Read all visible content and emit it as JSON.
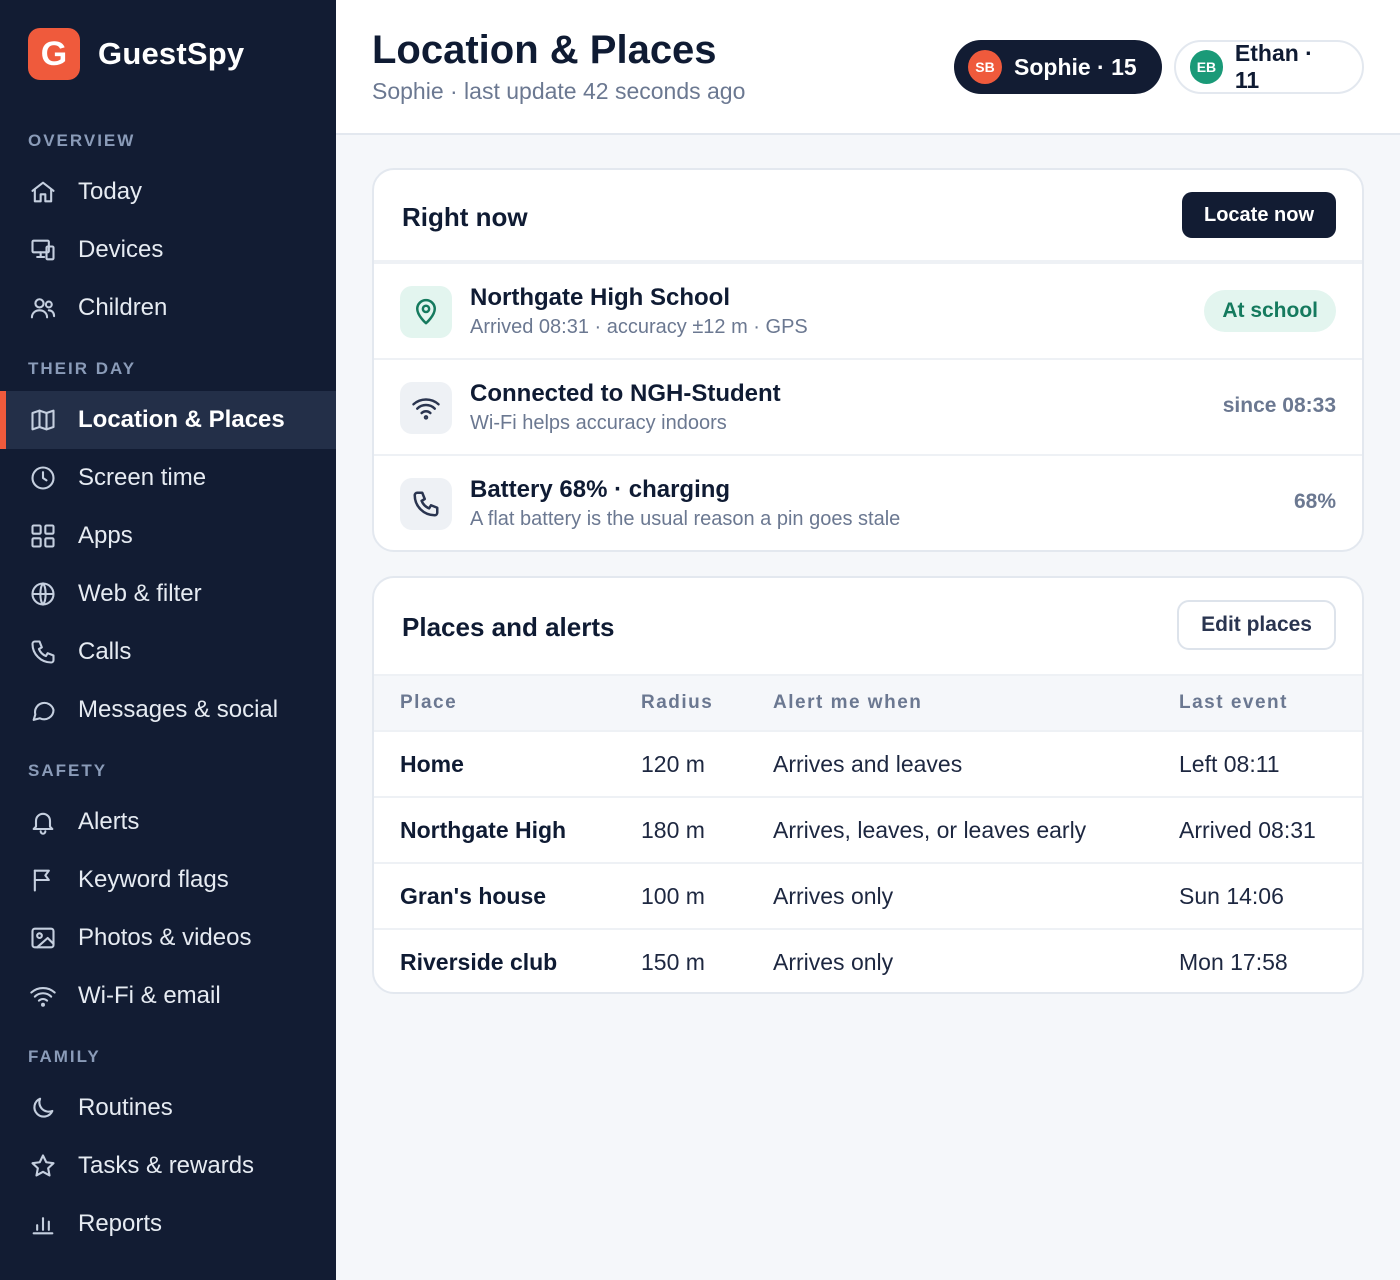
{
  "brand": {
    "logo_letter": "G",
    "name": "GuestSpy",
    "accent": "#ef5a3c"
  },
  "sidebar": {
    "sections": [
      {
        "label": "OVERVIEW",
        "items": [
          {
            "label": "Today",
            "icon": "home-icon"
          },
          {
            "label": "Devices",
            "icon": "devices-icon"
          },
          {
            "label": "Children",
            "icon": "users-icon"
          }
        ]
      },
      {
        "label": "THEIR DAY",
        "items": [
          {
            "label": "Location & Places",
            "icon": "map-icon",
            "active": true
          },
          {
            "label": "Screen time",
            "icon": "clock-icon"
          },
          {
            "label": "Apps",
            "icon": "grid-icon"
          },
          {
            "label": "Web & filter",
            "icon": "globe-icon"
          },
          {
            "label": "Calls",
            "icon": "phone-icon"
          },
          {
            "label": "Messages & social",
            "icon": "chat-icon"
          }
        ]
      },
      {
        "label": "SAFETY",
        "items": [
          {
            "label": "Alerts",
            "icon": "bell-icon"
          },
          {
            "label": "Keyword flags",
            "icon": "flag-icon"
          },
          {
            "label": "Photos & videos",
            "icon": "image-icon"
          },
          {
            "label": "Wi-Fi & email",
            "icon": "wifi-icon"
          }
        ]
      },
      {
        "label": "FAMILY",
        "items": [
          {
            "label": "Routines",
            "icon": "moon-icon"
          },
          {
            "label": "Tasks & rewards",
            "icon": "star-icon"
          },
          {
            "label": "Reports",
            "icon": "bar-chart-icon"
          }
        ]
      }
    ]
  },
  "header": {
    "title": "Location & Places",
    "subtitle": "Sophie · last update 42 seconds ago",
    "children": [
      {
        "initials": "SB",
        "label": "Sophie · 15",
        "avatar_color": "#ef5a3c",
        "selected": true
      },
      {
        "initials": "EB",
        "label": "Ethan · 11",
        "avatar_color": "#1a9a78",
        "selected": false
      }
    ]
  },
  "right_now": {
    "title": "Right now",
    "button": "Locate now",
    "rows": [
      {
        "icon": "location-pin-icon",
        "title": "Northgate High School",
        "subtitle": "Arrived 08:31 · accuracy ±12 m · GPS",
        "badge": "At school"
      },
      {
        "icon": "wifi-icon",
        "title": "Connected to NGH-Student",
        "subtitle": "Wi-Fi helps accuracy indoors",
        "right": "since 08:33"
      },
      {
        "icon": "phone-icon",
        "title": "Battery 68% · charging",
        "subtitle": "A flat battery is the usual reason a pin goes stale",
        "right": "68%"
      }
    ]
  },
  "places": {
    "title": "Places and alerts",
    "button": "Edit places",
    "columns": [
      "Place",
      "Radius",
      "Alert me when",
      "Last event"
    ],
    "rows": [
      [
        "Home",
        "120 m",
        "Arrives and leaves",
        "Left 08:11"
      ],
      [
        "Northgate High",
        "180 m",
        "Arrives, leaves, or leaves early",
        "Arrived 08:31"
      ],
      [
        "Gran's house",
        "100 m",
        "Arrives only",
        "Sun 14:06"
      ],
      [
        "Riverside club",
        "150 m",
        "Arrives only",
        "Mon 17:58"
      ]
    ]
  }
}
